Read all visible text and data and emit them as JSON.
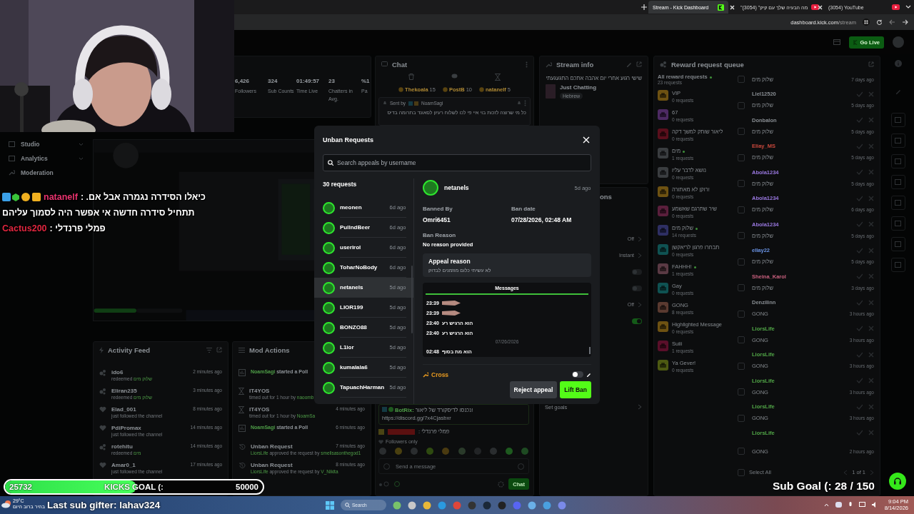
{
  "browser": {
    "tabs": [
      {
        "label": "Stream - Kick Dashboard",
        "kind": "kick",
        "selected": true
      },
      {
        "label": "\"מה הבעיה שלך עם קיק\" (3054)",
        "kind": "youtube",
        "selected": false
      },
      {
        "label": "(3054) YouTube",
        "kind": "youtube",
        "selected": false
      }
    ],
    "url_host": "dashboard.kick.com",
    "url_path": "/stream"
  },
  "header": {
    "go_live": "Go Live"
  },
  "sidebar": {
    "items": [
      "Studio",
      "Analytics",
      "Moderation"
    ]
  },
  "stats": [
    {
      "value": "6,426",
      "label": "Followers"
    },
    {
      "value": "324",
      "label": "Sub Counts"
    },
    {
      "value": "01:49:57",
      "label": "Time Live"
    },
    {
      "value": "23",
      "label": "Chatters in Avg."
    },
    {
      "value": "%1",
      "label": "Pa"
    }
  ],
  "chat": {
    "title": "Chat",
    "pinned_users": [
      {
        "name": "Thekoala",
        "count": "15"
      },
      {
        "name": "PostB",
        "count": "10"
      },
      {
        "name": "nataneIf",
        "count": "5"
      }
    ],
    "pinned": {
      "sent_by": "Sent by",
      "user": "NoamSagi",
      "text": "כל מי שרוצה לזכות בוי איי פי לכו לשלוח רעיון לסאונד בתרומה בדיס"
    },
    "bot_message": {
      "user": "BotRix:",
      "text": "!נכנסו לדיסקורד של ליאור",
      "link": "https://discord.gg/7x4Cjasbxr"
    },
    "message": {
      "text": "פמלי פרנדלי :"
    },
    "mode": "Followers only",
    "placeholder": "Send a message",
    "send": "Chat"
  },
  "stream_info": {
    "title": "Stream info",
    "stream_title": "שישי רגוע אחרי יום אהבה אתכם התגעגעתי",
    "category": "Just Chatting",
    "tag": "Hebrew"
  },
  "settings": {
    "heading": "ons",
    "items": [
      {
        "kind": "value",
        "value": "Off"
      },
      {
        "kind": "value",
        "value": "Instant"
      },
      {
        "kind": "toggle",
        "on": false
      },
      {
        "kind": "toggle",
        "on": false
      },
      {
        "kind": "value",
        "value": "Off"
      },
      {
        "kind": "toggle",
        "on": true
      }
    ],
    "goals": "Set goals"
  },
  "reward_queue": {
    "title": "Reward request queue",
    "all": "All reward requests",
    "total": "23 requests",
    "rewards": [
      {
        "name": "VIP",
        "count": "0 requests",
        "color": "#6e5212",
        "active": false
      },
      {
        "name": "67",
        "count": "0 requests",
        "color": "#4d2a63",
        "active": false
      },
      {
        "name": "ליאור שותק למשך דקה",
        "count": "0 requests",
        "color": "#5a0f1c",
        "active": false
      },
      {
        "name": "מים",
        "count": "1 requests",
        "color": "#3a3d40",
        "active": true
      },
      {
        "name": "נושא לדבר עליו",
        "count": "0 requests",
        "color": "#3a3d40",
        "active": false
      },
      {
        "name": "רוקן לא מאתורה!",
        "count": "0 requests",
        "color": "#6e5212",
        "active": false
      },
      {
        "name": "שיר שתרגם שאשמע",
        "count": "0 requests",
        "color": "#5a1f3c",
        "active": false
      },
      {
        "name": "שלוק מים",
        "count": "14 requests",
        "color": "#2e2f63",
        "active": true
      },
      {
        "name": "תבחרו פרגון לריאקשן",
        "count": "0 requests",
        "color": "#0f5252",
        "active": false
      },
      {
        "name": "FAHHH!",
        "count": "1 requests",
        "color": "#5a3a44",
        "active": true
      },
      {
        "name": "Gay",
        "count": "0 requests",
        "color": "#0f5252",
        "active": false
      },
      {
        "name": "GONG",
        "count": "8 requests",
        "color": "#5a3a30",
        "active": false
      },
      {
        "name": "Highlighted Message",
        "count": "0 requests",
        "color": "#6e5212",
        "active": false
      },
      {
        "name": "Suiii",
        "count": "1 requests",
        "color": "#5a0f2a",
        "active": false
      },
      {
        "name": "Ya Gever!",
        "count": "0 requests",
        "color": "#4d5a12",
        "active": false
      }
    ],
    "requests": [
      {
        "reward": "שלוק מים",
        "user": "Liel12520",
        "time": "7 days ago",
        "color": "#8a8f94",
        "checked": false
      },
      {
        "reward": "שלוק מים",
        "user": "Donbalon",
        "time": "5 days ago",
        "color": "#8a8f94",
        "checked": false
      },
      {
        "reward": "שלוק מים",
        "user": "Eliay_MS",
        "time": "5 days ago",
        "color": "#c8483c",
        "checked": false
      },
      {
        "reward": "שלוק מים",
        "user": "Abola1234",
        "time": "5 days ago",
        "color": "#9a78e0",
        "checked": false
      },
      {
        "reward": "שלוק מים",
        "user": "Abola1234",
        "time": "5 days ago",
        "color": "#9a78e0",
        "checked": false
      },
      {
        "reward": "שלוק מים",
        "user": "Abola1234",
        "time": "6 days ago",
        "color": "#9a78e0",
        "checked": false
      },
      {
        "reward": "שלוק מים",
        "user": "ellay22",
        "time": "5 days ago",
        "color": "#6a94e6",
        "checked": false
      },
      {
        "reward": "שלוק מים",
        "user": "Sheina_Karol",
        "time": "5 days ago",
        "color": "#c8607e",
        "checked": false
      },
      {
        "reward": "שלוק מים",
        "user": "Denzilinn",
        "time": "3 days ago",
        "color": "#8a8f94",
        "checked": false
      },
      {
        "reward": "GONG",
        "user": "LiorsLife",
        "time": "3 hours ago",
        "color": "#52a848",
        "checked": false
      },
      {
        "reward": "GONG",
        "user": "LiorsLife",
        "time": "3 hours ago",
        "color": "#52a848",
        "checked": false
      },
      {
        "reward": "GONG",
        "user": "LiorsLife",
        "time": "3 hours ago",
        "color": "#52a848",
        "checked": false
      },
      {
        "reward": "GONG",
        "user": "LiorsLife",
        "time": "3 hours ago",
        "color": "#52a848",
        "checked": false
      },
      {
        "reward": "GONG",
        "user": "LiorsLife",
        "time": "3 hours ago",
        "color": "#52a848",
        "checked": false
      },
      {
        "reward": "GONG",
        "time": "2 hours ago",
        "checked": false
      }
    ],
    "select_all": "Select All",
    "select_all_checked": false,
    "pages": "1 of 1"
  },
  "activity_feed": {
    "title": "Activity Feed",
    "items": [
      {
        "kind": "redeem",
        "user": "ido6",
        "action": "redeemed",
        "target": "שלוק מים",
        "time": "2 minutes ago"
      },
      {
        "kind": "redeem",
        "user": "Eliran235",
        "action": "redeemed",
        "target": "שלוק מים",
        "time": "3 minutes ago"
      },
      {
        "kind": "follow",
        "user": "Elad_001",
        "action": "just followed the channel",
        "time": "8 minutes ago"
      },
      {
        "kind": "follow",
        "user": "PdiPromax",
        "action": "just followed the channel",
        "time": "14 minutes ago"
      },
      {
        "kind": "redeem",
        "user": "rotehitu",
        "action": "redeemed",
        "target": "מים",
        "time": "14 minutes ago"
      },
      {
        "kind": "follow",
        "user": "Amar0_1",
        "action": "just followed the channel",
        "time": "17 minutes ago"
      }
    ]
  },
  "mod_actions": {
    "title": "Mod Actions",
    "items": [
      {
        "kind": "poll",
        "user": "NoamSagi",
        "action": "started a Poll"
      },
      {
        "kind": "timeout",
        "user": "IT4YOS",
        "detail": "timed out for 1 hour by",
        "by": "naoomb"
      },
      {
        "kind": "timeout",
        "user": "IT4YOS",
        "detail": "timed out for 1 hour by",
        "by": "NoamSa",
        "time": "4 minutes ago"
      },
      {
        "kind": "poll",
        "user": "NoamSagi",
        "action": "started a Poll",
        "time": "6 minutes ago"
      },
      {
        "kind": "unban",
        "title": "Unban Request",
        "user": "LiorsLife",
        "detail": "approved the request by",
        "by": "smellsasonthegod1",
        "time": "7 minutes ago"
      },
      {
        "kind": "unban",
        "title": "Unban Request",
        "user": "LiorsLife",
        "detail": "approved the request by",
        "by": "V_Nikita",
        "time": "8 minutes ago"
      }
    ]
  },
  "overlay": {
    "chat_lines": [
      {
        "user": "natanelf",
        "color": "#e8336e",
        "badges": true,
        "text": "כיאלו הסידרה נגמרה אבל אם. :"
      },
      {
        "text": "תתחיל סידרה חדשה אי אפשר היה לסמוך עליהם"
      },
      {
        "user": "Cactus200",
        "color": "#e0263f",
        "badges": false,
        "text": "פמלי פרנדלי :"
      }
    ],
    "kicks_goal": {
      "current": "25732",
      "label": "KICKS GOAL (:",
      "target": "50000",
      "level": 0.51
    },
    "sub_goal": "Sub Goal (: 28 / 150",
    "last_gifter": "Last sub gifter: lahav324",
    "weather": {
      "temp": "29°C",
      "text": "בהיר ברוב היום"
    }
  },
  "modal": {
    "title": "Unban Requests",
    "search_placeholder": "Search appeals by username",
    "count": "30 requests",
    "requests": [
      {
        "user": "meonen",
        "time": "6d ago",
        "selected": false
      },
      {
        "user": "PullndBeer",
        "time": "6d ago",
        "selected": false
      },
      {
        "user": "userirol",
        "time": "6d ago",
        "selected": false
      },
      {
        "user": "ToharNoBody",
        "time": "6d ago",
        "selected": false
      },
      {
        "user": "netanels",
        "time": "5d ago",
        "selected": true
      },
      {
        "user": "LIOR199",
        "time": "5d ago",
        "selected": false
      },
      {
        "user": "BONZO88",
        "time": "5d ago",
        "selected": false
      },
      {
        "user": "L1ior",
        "time": "5d ago",
        "selected": false
      },
      {
        "user": "kumalala6",
        "time": "5d ago",
        "selected": false
      },
      {
        "user": "TapuachHarman",
        "time": "5d ago",
        "selected": false
      }
    ],
    "detail": {
      "user": "netanels",
      "time": "5d ago",
      "banned_by_label": "Banned By",
      "banned_by": "Omri6451",
      "ban_date_label": "Ban date",
      "ban_date": "07/28/2026, 02:48 AM",
      "reason_label": "Ban Reason",
      "reason": "No reason provided",
      "appeal_label": "Appeal reason",
      "appeal": "לא עשיתי כלום מוזמנים לבדוק",
      "messages_tab": "Messages",
      "messages": [
        {
          "time": "23:39"
        },
        {
          "time": "23:39"
        },
        {
          "kind": "text",
          "time": "23:40",
          "text": "הוא הרגיש רע"
        },
        {
          "kind": "text",
          "time": "23:40",
          "text": "הוא הרגיש רע"
        },
        {
          "kind": "date",
          "text": "07/26/2026"
        },
        {
          "kind": "text",
          "time": "02:48",
          "text": "הוא מת בסוף"
        }
      ],
      "moderator": "Cross",
      "toggle_on": false,
      "reject": "Reject appeal",
      "lift": "Lift Ban"
    }
  },
  "taskbar": {
    "search": "Search",
    "time": "9:04 PM",
    "date": "8/14/2026"
  }
}
